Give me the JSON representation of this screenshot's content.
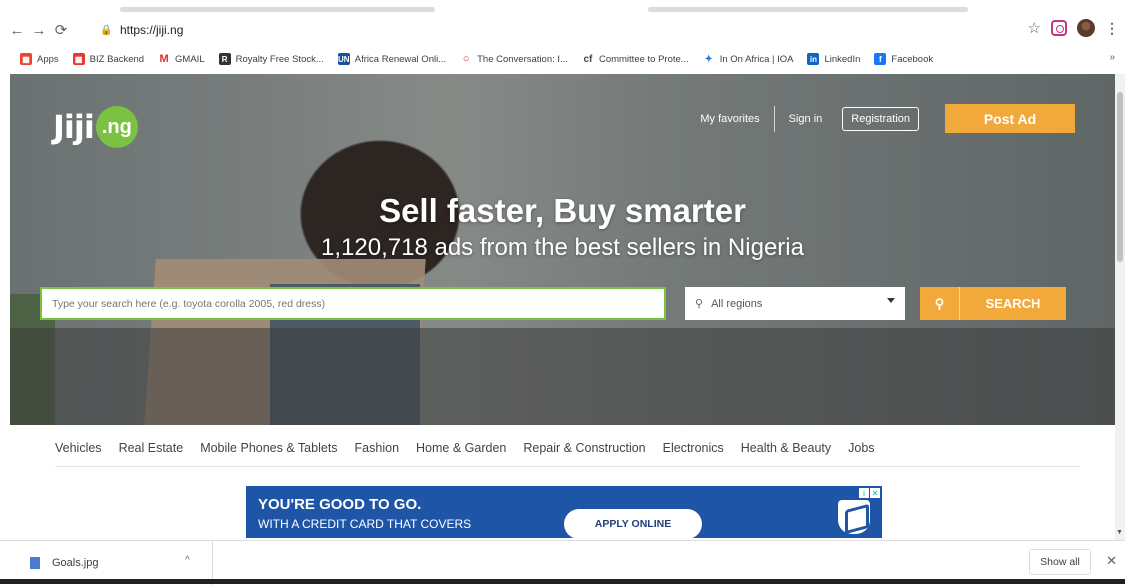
{
  "browser": {
    "url": "https://jiji.ng",
    "bookmarks": [
      {
        "label": "Apps",
        "color": "#ea4335",
        "icon": "apps-grid-icon"
      },
      {
        "label": "BIZ Backend",
        "color": "#e53935",
        "icon": "grid-icon"
      },
      {
        "label": "GMAIL",
        "color": "#d93025",
        "icon": "gmail-icon"
      },
      {
        "label": "Royalty Free Stock...",
        "color": "#333333",
        "icon": "stock-icon"
      },
      {
        "label": "Africa Renewal Onli...",
        "color": "#1a4f9c",
        "icon": "un-icon"
      },
      {
        "label": "The Conversation: I...",
        "color": "#d62828",
        "icon": "conversation-icon"
      },
      {
        "label": "Committee to Prote...",
        "color": "#444444",
        "icon": "cpj-icon"
      },
      {
        "label": "In On Africa | IOA",
        "color": "#2a7fd4",
        "icon": "ioa-icon"
      },
      {
        "label": "LinkedIn",
        "color": "#0a66c2",
        "icon": "linkedin-icon"
      },
      {
        "label": "Facebook",
        "color": "#1877f2",
        "icon": "facebook-icon"
      }
    ],
    "more": "»"
  },
  "site": {
    "logo_text": "Jiji",
    "logo_ng": ".ng",
    "nav": {
      "favorites": "My favorites",
      "signin": "Sign in",
      "registration": "Registration",
      "postad": "Post Ad"
    },
    "headline": "Sell faster, Buy smarter",
    "subline": "1,120,718 ads from the best sellers in Nigeria",
    "search": {
      "placeholder": "Type your search here (e.g. toyota corolla 2005, red dress)",
      "region": "All regions",
      "button": "SEARCH"
    },
    "categories": [
      "Vehicles",
      "Real Estate",
      "Mobile Phones & Tablets",
      "Fashion",
      "Home & Garden",
      "Repair & Construction",
      "Electronics",
      "Health & Beauty",
      "Jobs"
    ],
    "ad": {
      "line1": "YOU'RE GOOD TO GO.",
      "line2": "WITH A CREDIT CARD THAT COVERS",
      "button": "APPLY ONLINE"
    }
  },
  "downloads": {
    "file": "Goals.jpg",
    "show_all": "Show all"
  },
  "colors": {
    "accent_orange": "#f0a93a",
    "brand_green": "#7cc242",
    "ad_blue": "#1f55a6"
  }
}
